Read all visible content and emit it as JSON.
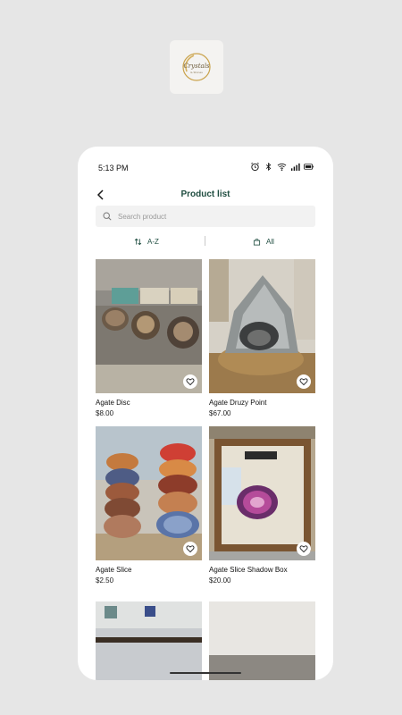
{
  "colors": {
    "accent": "#1f4d40",
    "background": "#e6e6e6"
  },
  "logo": {
    "icon": "crystals-logo",
    "text": "Crystals",
    "subtext": "& Stones"
  },
  "status_bar": {
    "time": "5:13 PM",
    "icons": [
      "alarm-icon",
      "bluetooth-icon",
      "wifi-icon",
      "signal-icon",
      "battery-icon"
    ]
  },
  "header": {
    "title": "Product list",
    "back_icon": "chevron-left-icon"
  },
  "search": {
    "placeholder": "Search product",
    "value": ""
  },
  "filters": {
    "sort_label": "A-Z",
    "sort_icon": "sort-arrows-icon",
    "category_label": "All",
    "category_icon": "bag-icon"
  },
  "products": [
    {
      "name": "Agate Disc",
      "price": "$8.00"
    },
    {
      "name": "Agate Druzy Point",
      "price": "$67.00"
    },
    {
      "name": "Agate Slice",
      "price": "$2.50"
    },
    {
      "name": "Agate Slice Shadow Box",
      "price": "$20.00"
    }
  ]
}
